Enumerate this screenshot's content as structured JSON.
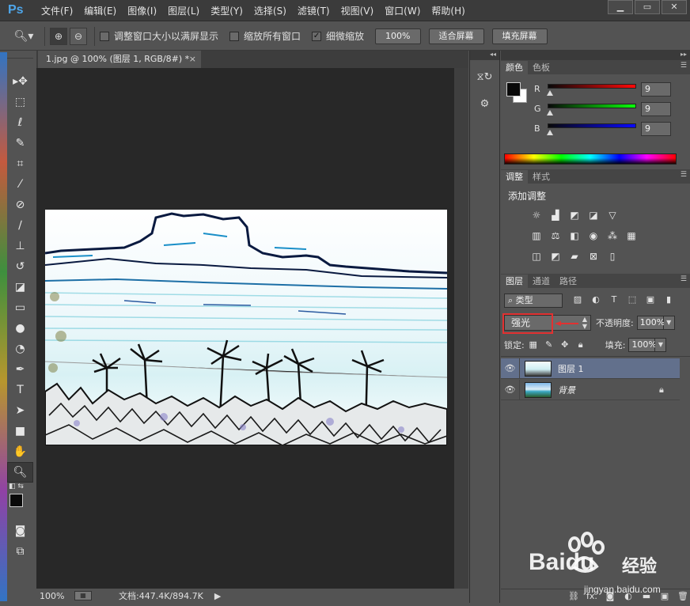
{
  "app": {
    "logo_text": "Ps"
  },
  "menu": [
    "文件(F)",
    "编辑(E)",
    "图像(I)",
    "图层(L)",
    "类型(Y)",
    "选择(S)",
    "滤镜(T)",
    "视图(V)",
    "窗口(W)",
    "帮助(H)"
  ],
  "options": {
    "resize_windows_label": "调整窗口大小以满屏显示",
    "resize_windows_checked": false,
    "zoom_all_label": "缩放所有窗口",
    "zoom_all_checked": false,
    "scrubby_label": "细微缩放",
    "scrubby_checked": true,
    "btn_100": "100%",
    "btn_fit": "适合屏幕",
    "btn_fill": "填充屏幕"
  },
  "document": {
    "tab_title": "1.jpg @ 100% (图层 1, RGB/8#) *",
    "close_glyph": "×"
  },
  "status": {
    "zoom": "100%",
    "doc_size": "文档:447.4K/894.7K"
  },
  "color_panel": {
    "tabs": [
      "颜色",
      "色板"
    ],
    "r_label": "R",
    "r_value": "9",
    "g_label": "G",
    "g_value": "9",
    "b_label": "B",
    "b_value": "9",
    "fg_color": "#090909",
    "bg_color": "#ffffff"
  },
  "adjust_panel": {
    "tabs": [
      "调整",
      "样式"
    ],
    "title": "添加调整"
  },
  "layers_panel": {
    "tabs": [
      "图层",
      "通道",
      "路径"
    ],
    "kind_filter": "类型",
    "blend_mode": "强光",
    "opacity_label": "不透明度:",
    "opacity_value": "100%",
    "lock_label": "锁定:",
    "fill_label": "填充:",
    "fill_value": "100%",
    "layers": [
      {
        "name": "图层 1",
        "selected": true,
        "locked": false
      },
      {
        "name": "背景",
        "selected": false,
        "locked": true
      }
    ],
    "footer_fx": "fx."
  },
  "watermark": {
    "brand": "Baidu",
    "brand_cn": "经验",
    "url": "jingyan.baidu.com"
  }
}
